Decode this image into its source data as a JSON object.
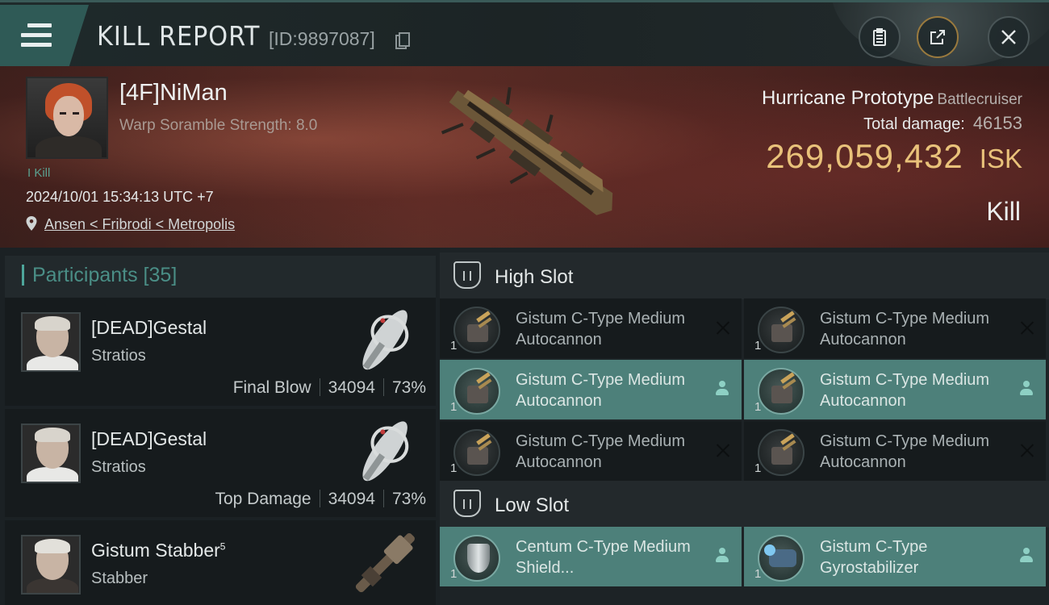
{
  "header": {
    "title": "KILL REPORT",
    "report_id": "[ID:9897087]"
  },
  "victim": {
    "name": "[4F]NiMan",
    "subtitle": "Warp Soramble Strength: 8.0",
    "kill_tag": "I Kill",
    "timestamp": "2024/10/01 15:34:13 UTC +7",
    "location": "Ansen < Fribrodi < Metropolis",
    "ship_name": "Hurricane Prototype",
    "ship_class": "Battlecruiser",
    "damage_label": "Total damage:",
    "damage_value": "46153",
    "isk_value": "269,059,432",
    "isk_unit": "ISK",
    "result": "Kill"
  },
  "participants": {
    "header": "Participants [35]",
    "items": [
      {
        "name": "[DEAD]Gestal",
        "name_sup": "",
        "ship": "Stratios",
        "role": "Final Blow",
        "damage": "34094",
        "percent": "73%"
      },
      {
        "name": "[DEAD]Gestal",
        "name_sup": "",
        "ship": "Stratios",
        "role": "Top Damage",
        "damage": "34094",
        "percent": "73%"
      },
      {
        "name": "Gistum Stabber",
        "name_sup": "5",
        "ship": "Stabber",
        "role": "",
        "damage": "",
        "percent": ""
      }
    ]
  },
  "slots": {
    "high": {
      "label": "High Slot",
      "modules": [
        {
          "name": "Gistum C-Type Medium Autocannon",
          "qty": "1",
          "state": "destroyed"
        },
        {
          "name": "Gistum C-Type Medium Autocannon",
          "qty": "1",
          "state": "destroyed"
        },
        {
          "name": "Gistum C-Type Medium Autocannon",
          "qty": "1",
          "state": "dropped"
        },
        {
          "name": "Gistum C-Type Medium Autocannon",
          "qty": "1",
          "state": "dropped"
        },
        {
          "name": "Gistum C-Type Medium Autocannon",
          "qty": "1",
          "state": "destroyed"
        },
        {
          "name": "Gistum C-Type Medium Autocannon",
          "qty": "1",
          "state": "destroyed"
        }
      ]
    },
    "low": {
      "label": "Low Slot",
      "modules": [
        {
          "name": "Centum C-Type Medium Shield...",
          "qty": "1",
          "state": "dropped"
        },
        {
          "name": "Gistum C-Type Gyrostabilizer",
          "qty": "1",
          "state": "dropped"
        }
      ]
    }
  },
  "icons": {
    "menu": "menu-icon",
    "copy": "copy-icon",
    "clipboard": "clipboard-icon",
    "share": "share-icon",
    "close": "close-icon",
    "location": "location-pin-icon",
    "slot": "slot-icon",
    "destroyed": "x-icon",
    "dropped": "pilot-icon"
  },
  "colors": {
    "accent_teal": "#4d807a",
    "isk_gold": "#e9c27a",
    "hero_red": "#5a2d26"
  }
}
